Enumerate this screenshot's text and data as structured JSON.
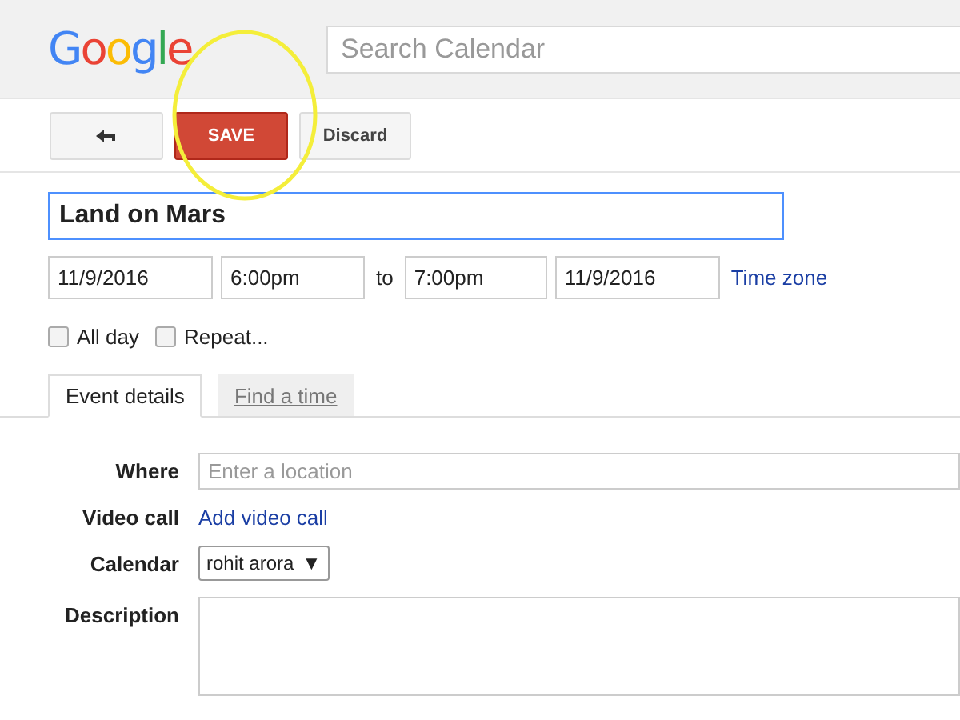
{
  "header": {
    "logo": "Google",
    "search": {
      "placeholder": "Search Calendar"
    }
  },
  "toolbar": {
    "buttons": [
      {
        "kind": "back"
      },
      {
        "kind": "primary",
        "label": "SAVE"
      },
      {
        "kind": "plain",
        "label": "Discard"
      }
    ]
  },
  "annotation": {
    "kind": "circle"
  },
  "event": {
    "title": "Land on Mars",
    "start_date": "11/9/2016",
    "start_time": "6:00pm",
    "to": "to",
    "end_time": "7:00pm",
    "end_date": "11/9/2016",
    "time_zone": "Time zone"
  },
  "options": [
    {
      "label": "All day",
      "checked": false
    },
    {
      "label": "Repeat...",
      "checked": false
    }
  ],
  "tabs": [
    {
      "label": "Event details",
      "selected": true
    },
    {
      "label": "Find a time",
      "selected": false
    }
  ],
  "details": [
    {
      "kind": "input",
      "label": "Where",
      "placeholder": "Enter a location"
    },
    {
      "kind": "link",
      "label": "Video call",
      "value": "Add video call"
    },
    {
      "kind": "select",
      "label": "Calendar",
      "value": "rohit arora",
      "caret": "▼"
    },
    {
      "kind": "textarea",
      "label": "Description"
    }
  ]
}
